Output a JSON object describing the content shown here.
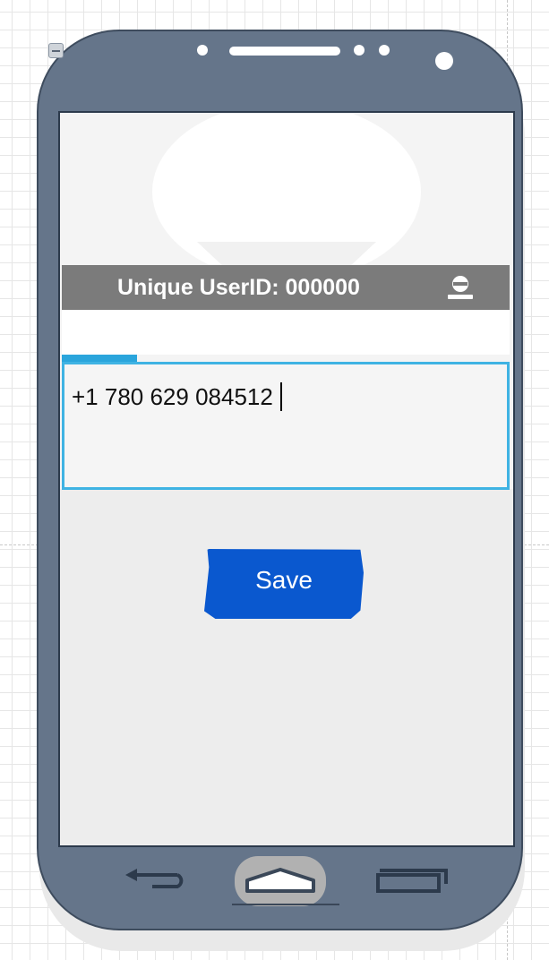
{
  "profile": {
    "userid_label": "Unique UserID: 000000"
  },
  "phone_input": {
    "value": "+1 780 629 084512"
  },
  "actions": {
    "save_label": "Save"
  },
  "icons": {
    "collapse": "minus-square-icon",
    "user": "user-icon",
    "back": "back-arrow-icon",
    "home": "home-icon",
    "recent": "recent-apps-icon"
  },
  "colors": {
    "phone_frame": "#65758a",
    "userid_bar": "#7b7b7b",
    "focus_border": "#3fb3e3",
    "save_button": "#0a58cf"
  }
}
